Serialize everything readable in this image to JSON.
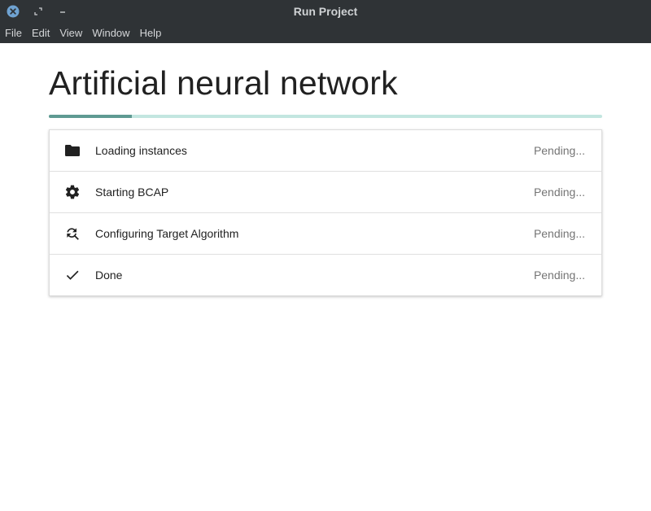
{
  "window": {
    "title": "Run Project"
  },
  "menu": {
    "items": [
      "File",
      "Edit",
      "View",
      "Window",
      "Help"
    ]
  },
  "project": {
    "title": "Artificial neural network",
    "progress_percent": 15
  },
  "tasks": [
    {
      "icon": "folder-icon",
      "label": "Loading instances",
      "status": "Pending..."
    },
    {
      "icon": "gear-icon",
      "label": "Starting BCAP",
      "status": "Pending..."
    },
    {
      "icon": "refresh-search-icon",
      "label": "Configuring Target Algorithm",
      "status": "Pending..."
    },
    {
      "icon": "checkmark-icon",
      "label": "Done",
      "status": "Pending..."
    }
  ],
  "colors": {
    "titlebar": "#2f3336",
    "close_button": "#6fa3d2",
    "progress_fill": "#5f9a92",
    "progress_track": "#c3e6e0"
  }
}
